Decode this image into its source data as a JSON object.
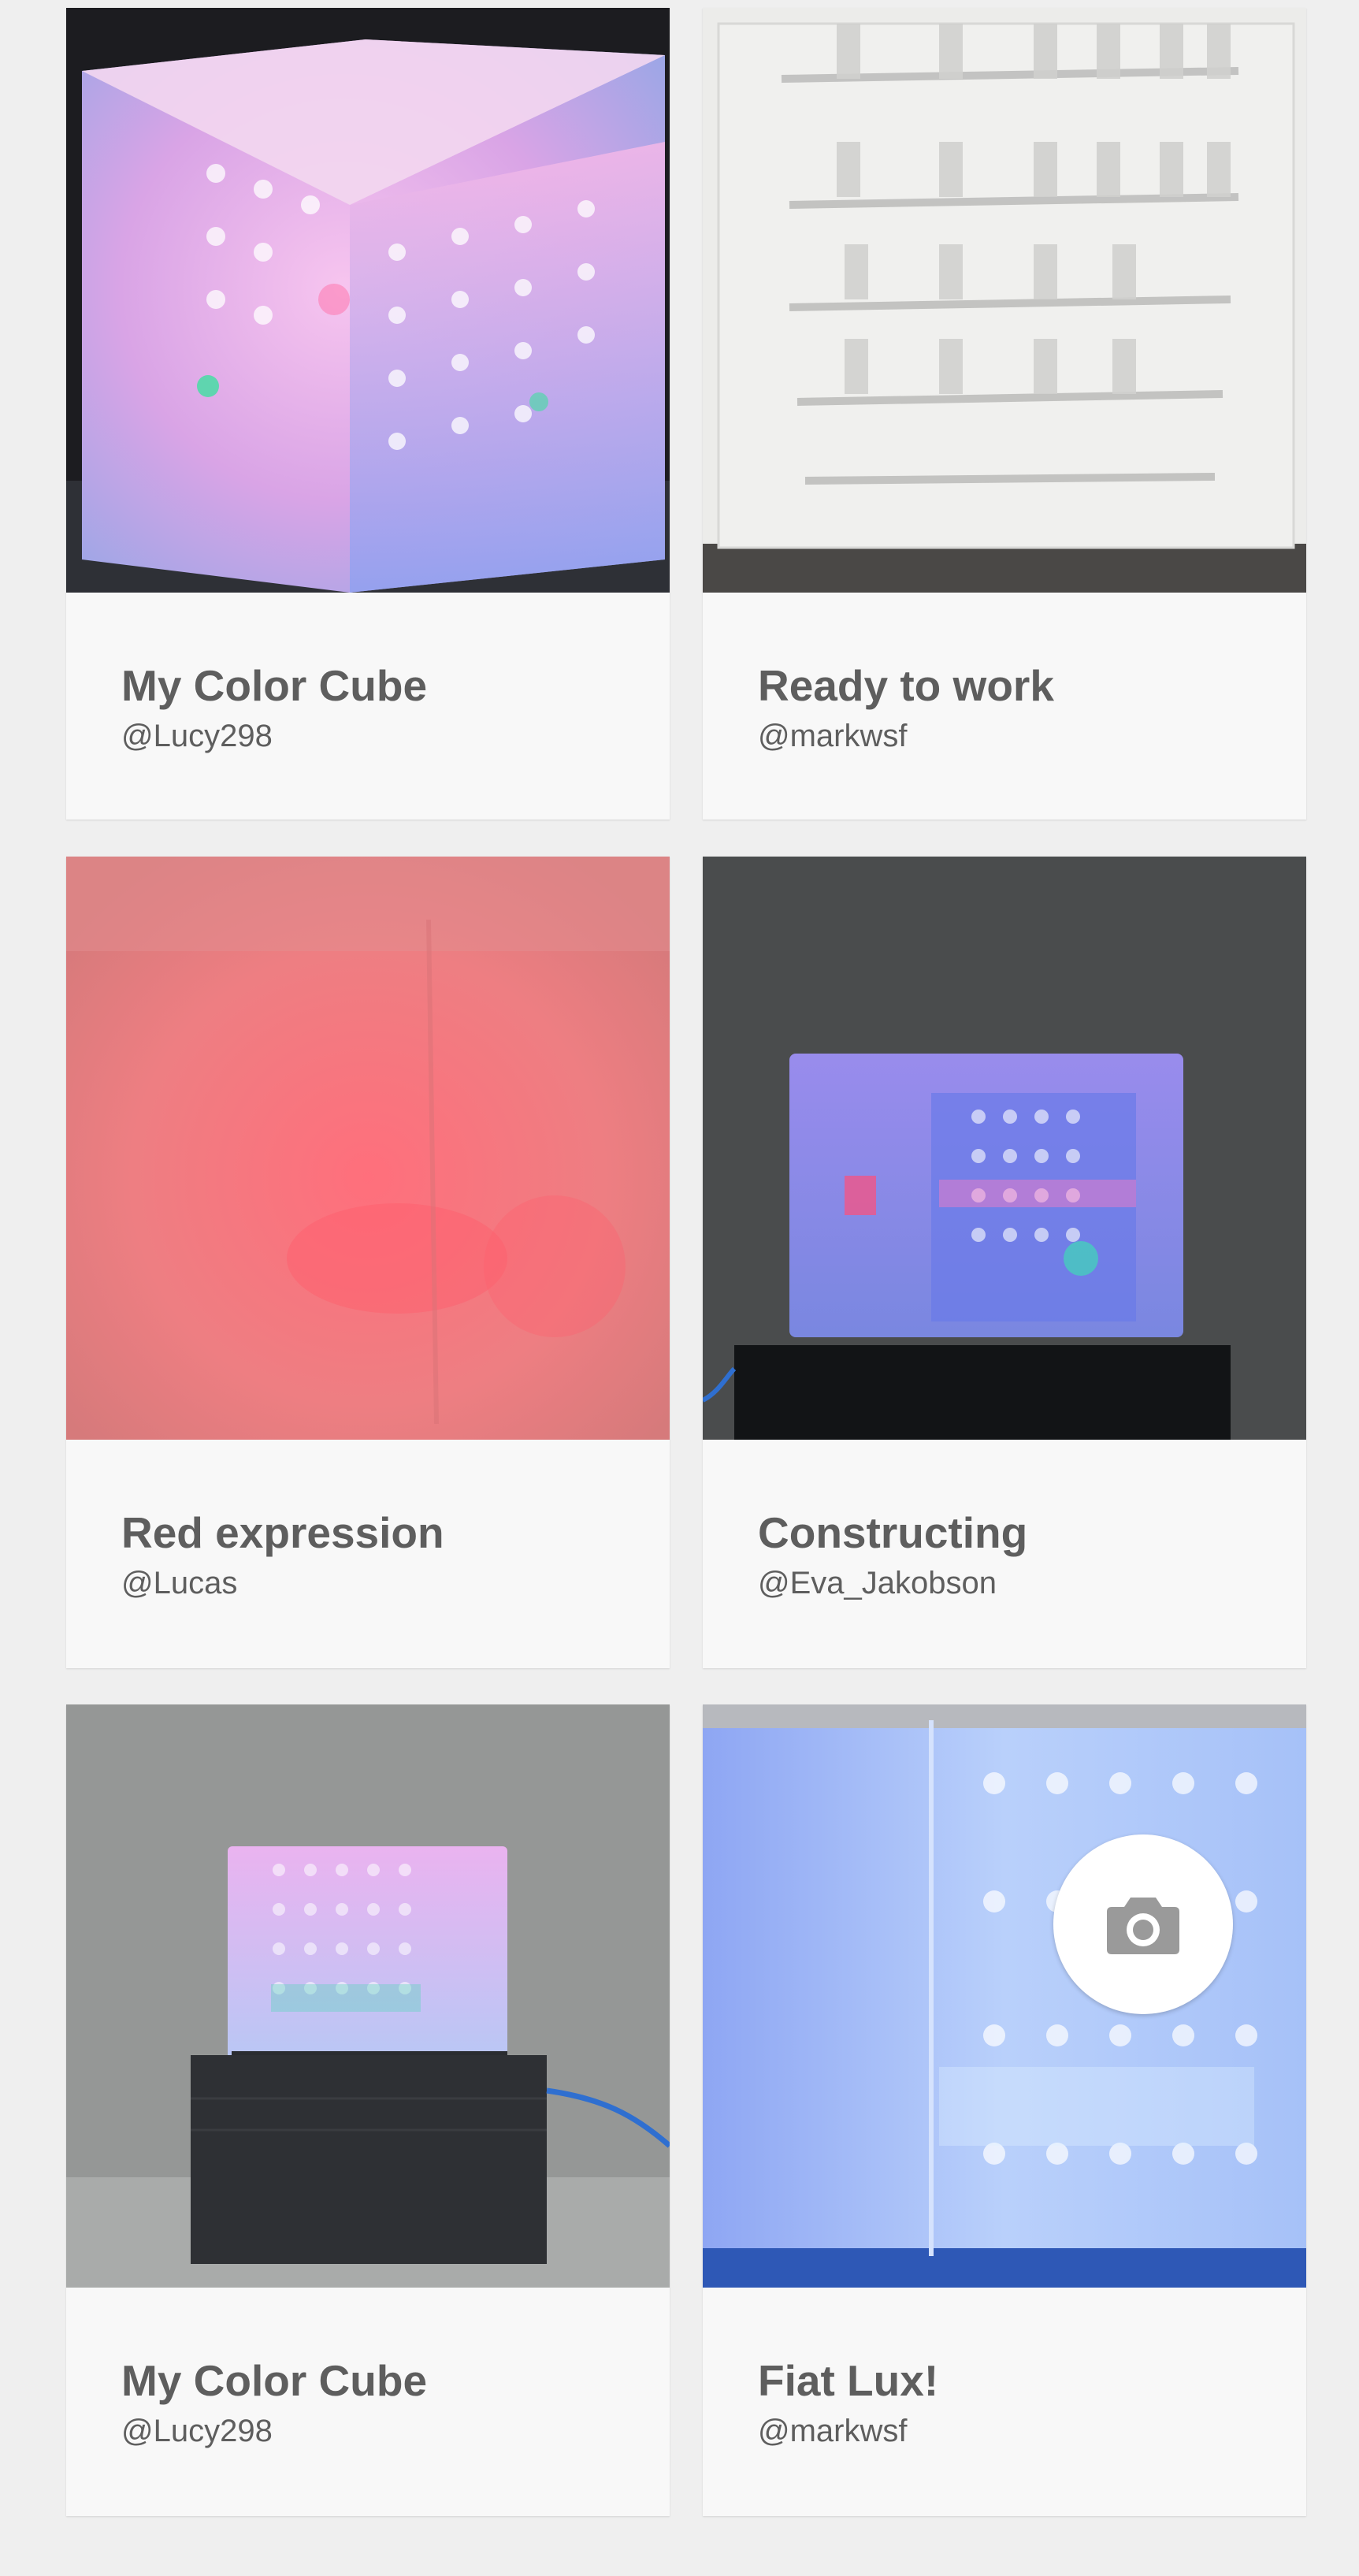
{
  "gallery": {
    "cards": [
      {
        "title": "My Color Cube",
        "author": "@Lucy298"
      },
      {
        "title": "Ready to work",
        "author": "@markwsf"
      },
      {
        "title": "Red expression",
        "author": "@Lucas"
      },
      {
        "title": "Constructing",
        "author": "@Eva_Jakobson"
      },
      {
        "title": "My Color Cube",
        "author": "@Lucy298"
      },
      {
        "title": "Fiat Lux!",
        "author": "@markwsf"
      }
    ]
  },
  "icons": {
    "upload": "camera-icon"
  },
  "colors": {
    "page_background": "#efefef",
    "card_background": "#f8f8f8",
    "text": "#5e5e5e",
    "fab_background": "#ffffff",
    "fab_icon": "#9a9a9a"
  }
}
